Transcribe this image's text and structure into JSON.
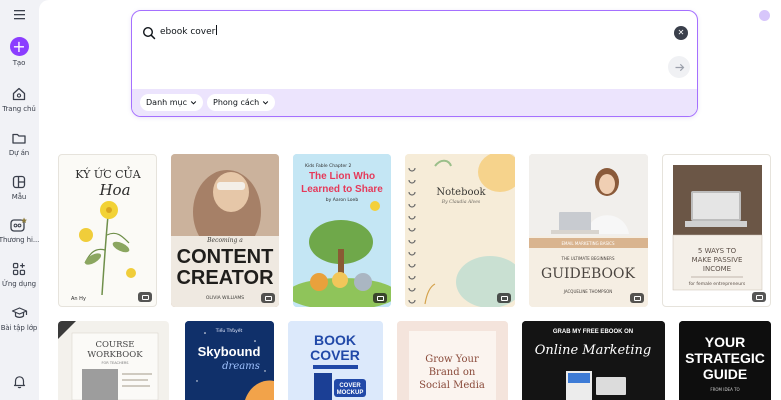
{
  "sidebar": {
    "items": [
      {
        "label": "Tạo",
        "icon": "plus-icon"
      },
      {
        "label": "Trang chủ",
        "icon": "home-icon"
      },
      {
        "label": "Dự án",
        "icon": "folder-icon"
      },
      {
        "label": "Mẫu",
        "icon": "template-icon"
      },
      {
        "label": "Thương hi...",
        "icon": "brand-icon"
      },
      {
        "label": "Ứng dụng",
        "icon": "apps-icon"
      },
      {
        "label": "Bài tập lớp",
        "icon": "graduation-cap-icon"
      }
    ]
  },
  "search": {
    "value": "ebook cover",
    "filters": [
      {
        "label": "Danh mục"
      },
      {
        "label": "Phong cách"
      }
    ]
  },
  "colors": {
    "accent": "#8b3dff",
    "filter_bar": "#ece4fd"
  },
  "templates_row1": [
    {
      "title": "KÝ ỨC CỦA",
      "script": "Hoa",
      "author": "An Hy"
    },
    {
      "kicker": "Becoming a",
      "title1": "CONTENT",
      "title2": "CREATOR",
      "author": "OLIVIA WILLIAMS"
    },
    {
      "series": "Kids Fable Chapter 2",
      "title1": "The Lion Who",
      "title2": "Learned to Share",
      "author": "by Aaron Loeb"
    },
    {
      "title": "Notebook",
      "subtitle": "By Claudia Alves"
    },
    {
      "kicker": "EMAIL MARKETING BASICS",
      "series": "THE ULTIMATE BEGINNERS",
      "title": "GUIDEBOOK",
      "author": "JACQUELINE THOMPSON"
    },
    {
      "title1": "5 WAYS TO",
      "title2": "MAKE PASSIVE",
      "title3": "INCOME",
      "subtitle": "for female entrepreneurs"
    }
  ],
  "templates_row2": [
    {
      "title1": "COURSE",
      "title2": "WORKBOOK",
      "subtitle": "FOR TEACHERS"
    },
    {
      "author": "Tiểu Thuyết",
      "title": "Skybound",
      "script": "dreams"
    },
    {
      "title1": "BOOK",
      "title2": "COVER",
      "badge1": "COVER",
      "badge2": "MOCKUP"
    },
    {
      "title1": "Grow Your",
      "title2": "Brand on",
      "title3": "Social Media"
    },
    {
      "kicker": "GRAB MY FREE EBOOK ON",
      "title": "Online Marketing"
    },
    {
      "title1": "YOUR",
      "title2": "STRATEGIC",
      "title3": "GUIDE",
      "subtitle": "FROM IDEA TO"
    }
  ]
}
